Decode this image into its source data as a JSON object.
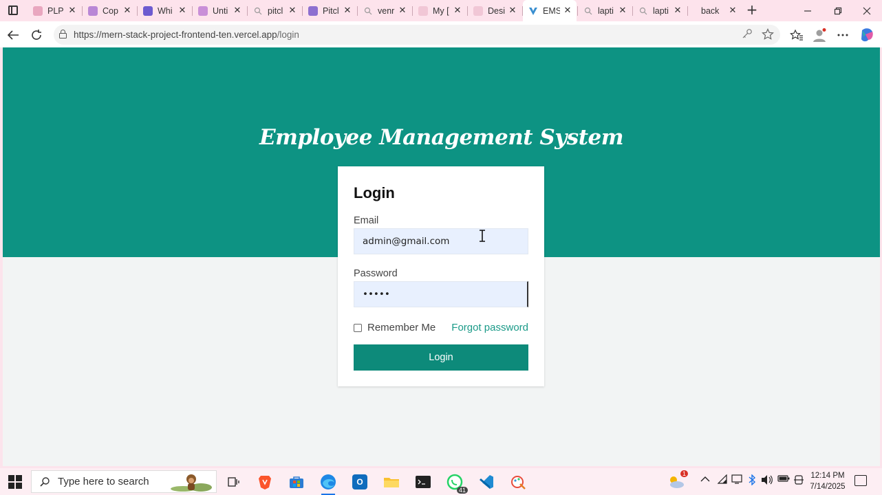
{
  "browser": {
    "tabs": [
      {
        "title": "PLP",
        "favicon_color": "#e9a7bf",
        "active": false
      },
      {
        "title": "Cop",
        "favicon_color": "#b987d6",
        "active": false
      },
      {
        "title": "Whi",
        "favicon_color": "#6d5bd0",
        "active": false
      },
      {
        "title": "Unti",
        "favicon_color": "#c98fd8",
        "active": false
      },
      {
        "title": "pitcl",
        "favicon_color": "search",
        "active": false
      },
      {
        "title": "Pitcl",
        "favicon_color": "#8d6fd0",
        "active": false
      },
      {
        "title": "venr",
        "favicon_color": "search",
        "active": false
      },
      {
        "title": "My [",
        "favicon_color": "#f1c7d6",
        "active": false
      },
      {
        "title": "Desi",
        "favicon_color": "#f1c7d6",
        "active": false
      },
      {
        "title": "EMS",
        "favicon_color": "#3a8fd0",
        "active": true
      },
      {
        "title": "lapti",
        "favicon_color": "search",
        "active": false
      },
      {
        "title": "lapti",
        "favicon_color": "search",
        "active": false
      },
      {
        "title": "back",
        "favicon_color": "none",
        "active": false
      }
    ],
    "url_host": "https://mern-stack-project-frontend-ten.vercel.app",
    "url_path": "/login"
  },
  "page": {
    "app_title": "Employee Management System",
    "form_title": "Login",
    "email_label": "Email",
    "email_value": "admin@gmail.com",
    "password_label": "Password",
    "password_value": "•••••",
    "remember_label": "Remember Me",
    "forgot_label": "Forgot password",
    "submit_label": "Login",
    "colors": {
      "primary": "#0d9383",
      "button": "#0d8a7a",
      "link": "#1a9a88",
      "page_bg": "#f2f4f4"
    }
  },
  "taskbar": {
    "search_placeholder": "Type here to search",
    "whatsapp_badge": "41",
    "weather_badge": "1",
    "time": "12:14 PM",
    "date": "7/14/2025"
  }
}
